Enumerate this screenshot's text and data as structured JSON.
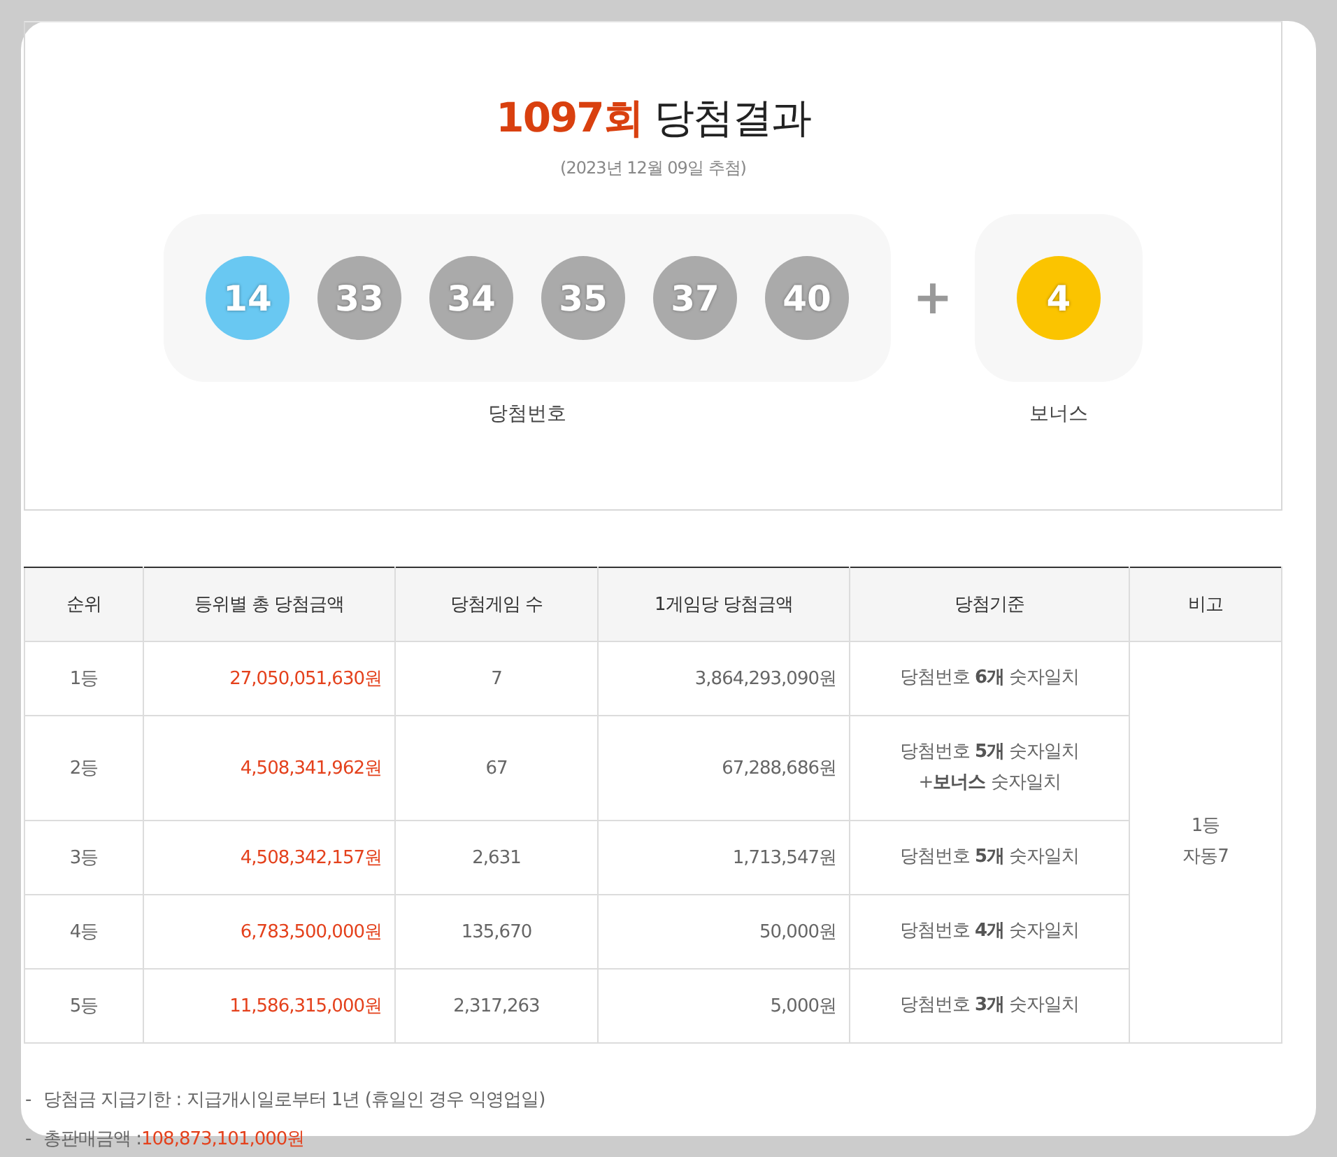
{
  "draw": {
    "round": "1097회",
    "title": "당첨결과",
    "date": "(2023년 12월 09일 추첨)",
    "numbers": [
      {
        "value": "14",
        "color": "#69c8f2"
      },
      {
        "value": "33",
        "color": "#aaaaaa"
      },
      {
        "value": "34",
        "color": "#aaaaaa"
      },
      {
        "value": "35",
        "color": "#aaaaaa"
      },
      {
        "value": "37",
        "color": "#aaaaaa"
      },
      {
        "value": "40",
        "color": "#aaaaaa"
      }
    ],
    "plus": "+",
    "bonus": {
      "value": "4",
      "color": "#fbc400"
    },
    "numbers_label": "당첨번호",
    "bonus_label": "보너스"
  },
  "table": {
    "columns": [
      "순위",
      "등위별 총 당첨금액",
      "당첨게임 수",
      "1게임당 당첨금액",
      "당첨기준",
      "비고"
    ],
    "rows": [
      {
        "rank": "1등",
        "total": "27,050,051,630원",
        "winners": "7",
        "per_game": "3,864,293,090원",
        "criteria": [
          "당첨번호 **6개** 숫자일치"
        ]
      },
      {
        "rank": "2등",
        "total": "4,508,341,962원",
        "winners": "67",
        "per_game": "67,288,686원",
        "criteria": [
          "당첨번호 **5개** 숫자일치",
          "+**보너스** 숫자일치"
        ]
      },
      {
        "rank": "3등",
        "total": "4,508,342,157원",
        "winners": "2,631",
        "per_game": "1,713,547원",
        "criteria": [
          "당첨번호 **5개** 숫자일치"
        ]
      },
      {
        "rank": "4등",
        "total": "6,783,500,000원",
        "winners": "135,670",
        "per_game": "50,000원",
        "criteria": [
          "당첨번호 **4개** 숫자일치"
        ]
      },
      {
        "rank": "5등",
        "total": "11,586,315,000원",
        "winners": "2,317,263",
        "per_game": "5,000원",
        "criteria": [
          "당첨번호 **3개** 숫자일치"
        ]
      }
    ],
    "note": [
      "1등",
      "자동7"
    ]
  },
  "notes": [
    {
      "bullet": "-",
      "label": "당첨금 지급기한 : 지급개시일로부터 1년 (휴일인 경우 익영업일)"
    },
    {
      "bullet": "-",
      "label": "총판매금액 : ",
      "value": "108,873,101,000원"
    }
  ]
}
